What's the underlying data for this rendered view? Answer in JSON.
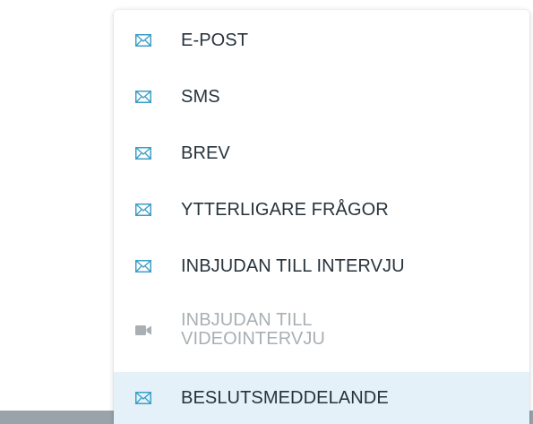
{
  "menu": {
    "items": [
      {
        "label": "E-POST",
        "icon": "envelope-icon",
        "enabled": true,
        "selected": false
      },
      {
        "label": "SMS",
        "icon": "envelope-icon",
        "enabled": true,
        "selected": false
      },
      {
        "label": "BREV",
        "icon": "envelope-icon",
        "enabled": true,
        "selected": false
      },
      {
        "label": "YTTERLIGARE FRÅGOR",
        "icon": "envelope-icon",
        "enabled": true,
        "selected": false
      },
      {
        "label": "INBJUDAN TILL INTERVJU",
        "icon": "envelope-icon",
        "enabled": true,
        "selected": false
      },
      {
        "label": "INBJUDAN TILL VIDEOINTERVJU",
        "icon": "video-camera-icon",
        "enabled": false,
        "selected": false
      },
      {
        "label": "BESLUTSMEDDELANDE",
        "icon": "envelope-icon",
        "enabled": true,
        "selected": true
      }
    ]
  },
  "colors": {
    "icon": "#3d9fc8",
    "icon_disabled": "#a9afb3",
    "text": "#27333b",
    "text_disabled": "#a9afb3",
    "selected_background": "#e4f1f8",
    "bottom_bar": "#9aa3aa"
  }
}
